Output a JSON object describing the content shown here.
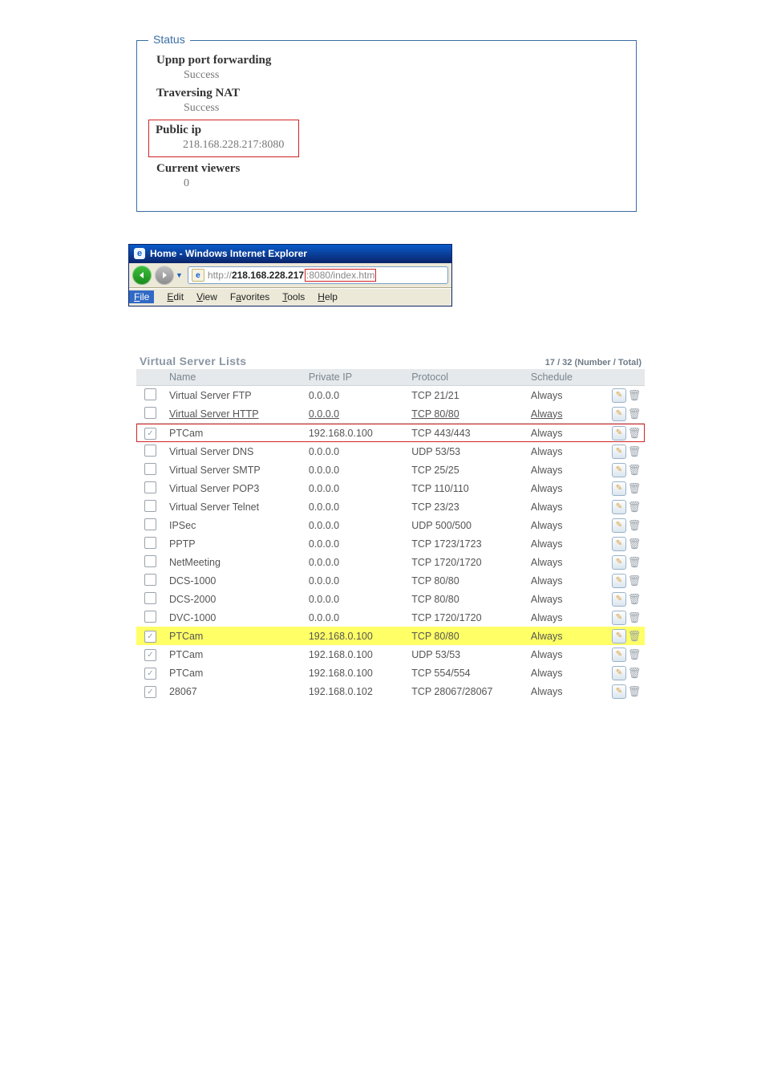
{
  "status": {
    "legend": "Status",
    "upnp_label": "Upnp port forwarding",
    "upnp_value": "Success",
    "nat_label": "Traversing NAT",
    "nat_value": "Success",
    "publicip_label": "Public ip",
    "publicip_value": "218.168.228.217:8080",
    "viewers_label": "Current viewers",
    "viewers_value": "0"
  },
  "ie": {
    "title": "Home - Windows Internet Explorer",
    "url_prefix": "http://",
    "url_host": "218.168.228.217",
    "url_suffix": ":8080/index.htm",
    "menu": {
      "file": "File",
      "edit": "Edit",
      "view": "View",
      "favorites": "Favorites",
      "tools": "Tools",
      "help": "Help"
    },
    "menu_mnemonics": {
      "file": "F",
      "edit": "E",
      "view": "V",
      "favorites": "a",
      "tools": "T",
      "help": "H"
    }
  },
  "vsl": {
    "title": "Virtual Server Lists",
    "count_text": "17 / 32 (Number / Total)",
    "columns": {
      "name": "Name",
      "private_ip": "Private IP",
      "protocol": "Protocol",
      "schedule": "Schedule"
    },
    "rows": [
      {
        "checked": false,
        "name": "Virtual Server FTP",
        "ip": "0.0.0.0",
        "proto": "TCP 21/21",
        "sched": "Always",
        "style": ""
      },
      {
        "checked": false,
        "name": "Virtual Server HTTP",
        "ip": "0.0.0.0",
        "proto": "TCP 80/80",
        "sched": "Always",
        "style": "http"
      },
      {
        "checked": true,
        "name": "PTCam",
        "ip": "192.168.0.100",
        "proto": "TCP 443/443",
        "sched": "Always",
        "style": "redbox"
      },
      {
        "checked": false,
        "name": "Virtual Server DNS",
        "ip": "0.0.0.0",
        "proto": "UDP 53/53",
        "sched": "Always",
        "style": ""
      },
      {
        "checked": false,
        "name": "Virtual Server SMTP",
        "ip": "0.0.0.0",
        "proto": "TCP 25/25",
        "sched": "Always",
        "style": ""
      },
      {
        "checked": false,
        "name": "Virtual Server POP3",
        "ip": "0.0.0.0",
        "proto": "TCP 110/110",
        "sched": "Always",
        "style": ""
      },
      {
        "checked": false,
        "name": "Virtual Server Telnet",
        "ip": "0.0.0.0",
        "proto": "TCP 23/23",
        "sched": "Always",
        "style": ""
      },
      {
        "checked": false,
        "name": "IPSec",
        "ip": "0.0.0.0",
        "proto": "UDP 500/500",
        "sched": "Always",
        "style": ""
      },
      {
        "checked": false,
        "name": "PPTP",
        "ip": "0.0.0.0",
        "proto": "TCP 1723/1723",
        "sched": "Always",
        "style": ""
      },
      {
        "checked": false,
        "name": "NetMeeting",
        "ip": "0.0.0.0",
        "proto": "TCP 1720/1720",
        "sched": "Always",
        "style": ""
      },
      {
        "checked": false,
        "name": "DCS-1000",
        "ip": "0.0.0.0",
        "proto": "TCP 80/80",
        "sched": "Always",
        "style": ""
      },
      {
        "checked": false,
        "name": "DCS-2000",
        "ip": "0.0.0.0",
        "proto": "TCP 80/80",
        "sched": "Always",
        "style": ""
      },
      {
        "checked": false,
        "name": "DVC-1000",
        "ip": "0.0.0.0",
        "proto": "TCP 1720/1720",
        "sched": "Always",
        "style": ""
      },
      {
        "checked": true,
        "name": "PTCam",
        "ip": "192.168.0.100",
        "proto": "TCP 80/80",
        "sched": "Always",
        "style": "yellow"
      },
      {
        "checked": true,
        "name": "PTCam",
        "ip": "192.168.0.100",
        "proto": "UDP 53/53",
        "sched": "Always",
        "style": ""
      },
      {
        "checked": true,
        "name": "PTCam",
        "ip": "192.168.0.100",
        "proto": "TCP 554/554",
        "sched": "Always",
        "style": ""
      },
      {
        "checked": true,
        "name": "28067",
        "ip": "192.168.0.102",
        "proto": "TCP 28067/28067",
        "sched": "Always",
        "style": ""
      }
    ]
  }
}
